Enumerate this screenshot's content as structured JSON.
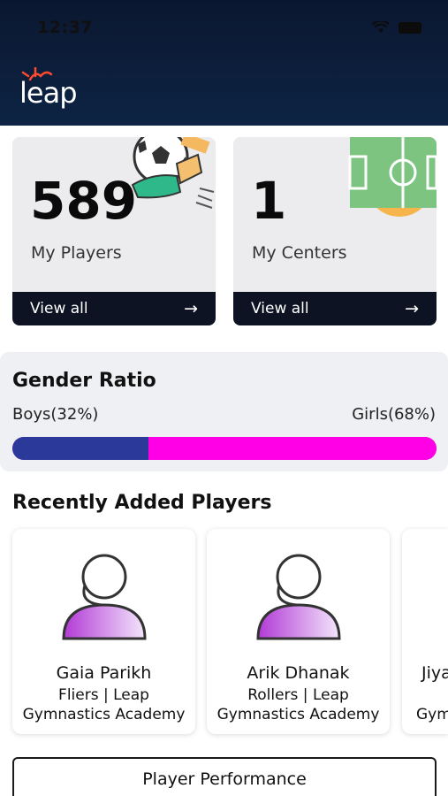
{
  "status_bar": {
    "time": "12:37"
  },
  "brand": {
    "logo_text": "leap"
  },
  "stats": [
    {
      "value": "589",
      "label": "My Players",
      "link": "View all"
    },
    {
      "value": "1",
      "label": "My Centers",
      "link": "View all"
    }
  ],
  "gender_ratio": {
    "title": "Gender Ratio",
    "boys_label": "Boys(32%)",
    "girls_label": "Girls(68%)",
    "boys_fraction": 0.32,
    "girls_fraction": 0.68,
    "boys_color": "#2b3a9a",
    "girls_color": "#ff00e6"
  },
  "recent": {
    "title": "Recently Added Players",
    "players": [
      {
        "name": "Gaia Parikh",
        "team": "Fliers | Leap",
        "academy": "Gymnastics Academy"
      },
      {
        "name": "Arik Dhanak",
        "team": "Rollers | Leap",
        "academy": "Gymnastics Academy"
      },
      {
        "name": "Jiya",
        "team": "",
        "academy": "Gym"
      }
    ]
  },
  "actions": {
    "performance_button": "Player Performance"
  },
  "colors": {
    "header": "#0b1730",
    "accent": "#ff00e6",
    "card_footer": "#0d1322"
  }
}
